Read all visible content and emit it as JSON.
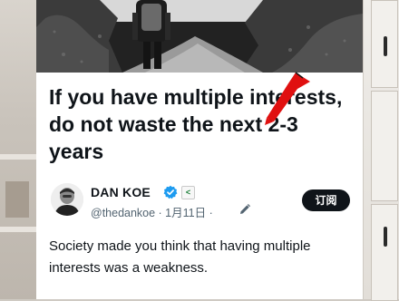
{
  "article": {
    "title": "If you have multiple interests, do not waste the next 2-3 years",
    "body": "Society made you think that having multiple interests was a weakness."
  },
  "author": {
    "name": "DAN KOE",
    "handle_line": "@thedankoe · 1月11日 ·",
    "affiliate_badge": "<"
  },
  "actions": {
    "subscribe_label": "订阅"
  },
  "colors": {
    "accent": "#1d9bf0",
    "button_bg": "#0f1419",
    "arrow": "#e01010"
  },
  "icons": [
    "verified-badge-icon",
    "affiliate-badge-icon",
    "edit-icon",
    "red-arrow-icon"
  ]
}
